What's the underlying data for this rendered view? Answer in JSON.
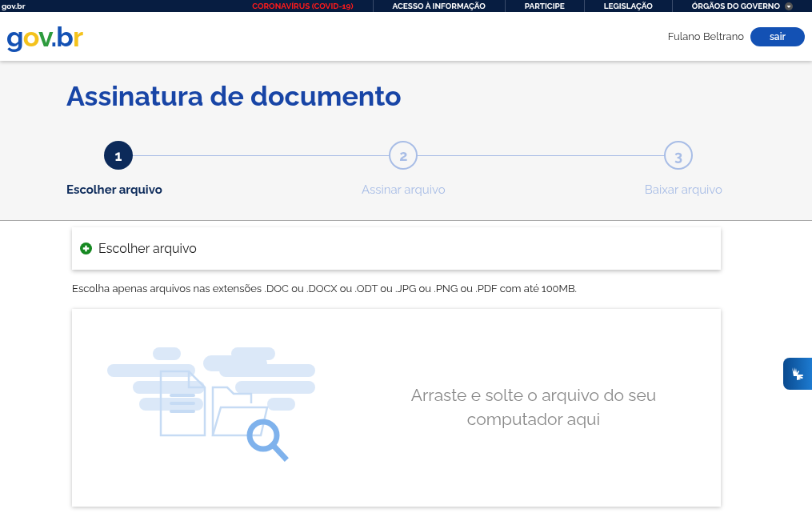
{
  "top_bar": {
    "brand": "gov.br",
    "links": [
      {
        "label": "CORONAVÍRUS (COVID-19)",
        "kind": "alert"
      },
      {
        "label": "ACESSO À INFORMAÇÃO",
        "kind": "normal"
      },
      {
        "label": "PARTICIPE",
        "kind": "normal"
      },
      {
        "label": "LEGISLAÇÃO",
        "kind": "normal"
      },
      {
        "label": "ÓRGÃOS DO GOVERNO",
        "kind": "menu"
      }
    ]
  },
  "header": {
    "logo": "gov.br",
    "user": "Fulano Beltrano",
    "logout": "sair"
  },
  "page_title": "Assinatura de documento",
  "steps": [
    {
      "number": "1",
      "label": "Escolher arquivo",
      "selected": true
    },
    {
      "number": "2",
      "label": "Assinar arquivo",
      "selected": false
    },
    {
      "number": "3",
      "label": "Baixar arquivo",
      "selected": false
    }
  ],
  "choose_panel": {
    "label": "Escolher arquivo"
  },
  "hint": "Escolha apenas arquivos nas extensões .DOC ou .DOCX ou .ODT ou .JPG ou .PNG ou .PDF com até 100MB.",
  "dropzone": {
    "text": "Arraste e solte o arquivo do seu computador aqui"
  }
}
